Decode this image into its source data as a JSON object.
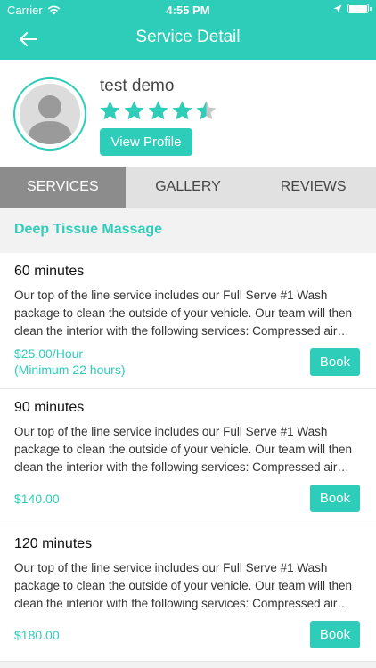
{
  "status_bar": {
    "carrier": "Carrier",
    "time": "4:55 PM"
  },
  "nav": {
    "title": "Service Detail"
  },
  "profile": {
    "name": "test demo",
    "rating": 4.5,
    "view_profile_label": "View Profile"
  },
  "tabs": [
    {
      "label": "SERVICES",
      "active": true
    },
    {
      "label": "GALLERY",
      "active": false
    },
    {
      "label": "REVIEWS",
      "active": false
    }
  ],
  "category": {
    "title": "Deep Tissue Massage"
  },
  "services": [
    {
      "duration": "60 minutes",
      "description": "Our top of the line service includes our Full Serve #1 Wash package to clean the outside of your vehicle. Our team will then clean the interior with the following services: Compressed air blow out, vacuum, and wipe down.",
      "price": "$25.00/Hour",
      "price_note": "(Minimum 22 hours)",
      "book_label": "Book"
    },
    {
      "duration": "90 minutes",
      "description": "Our top of the line service includes our Full Serve #1 Wash package to clean the outside of your vehicle. Our team will then clean the interior with the following services: Compressed air blow out, vacuum, and wipe down.",
      "price": "$140.00",
      "price_note": "",
      "book_label": "Book"
    },
    {
      "duration": "120 minutes",
      "description": "Our top of the line service includes our Full Serve #1 Wash package to clean the outside of your vehicle. Our team will then clean the interior with the following services: Compressed air blow out, vacuum, and wipe down.",
      "price": "$180.00",
      "price_note": "",
      "book_label": "Book"
    }
  ],
  "colors": {
    "accent": "#2ecdba",
    "tab_active": "#8c8c8c",
    "tab_bg": "#e1e1e1"
  }
}
